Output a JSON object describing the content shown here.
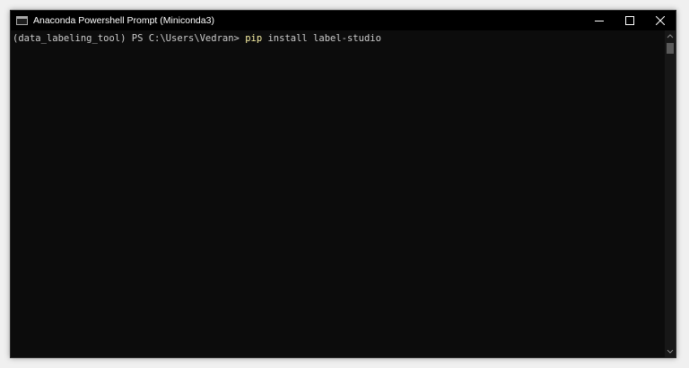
{
  "window": {
    "title": "Anaconda Powershell Prompt (Miniconda3)",
    "icon": "terminal-icon"
  },
  "controls": {
    "minimize": "minimize-icon",
    "maximize": "maximize-icon",
    "close": "close-icon"
  },
  "terminal": {
    "prompt": "(data_labeling_tool) PS C:\\Users\\Vedran> ",
    "command": "pip",
    "arguments": " install label-studio"
  },
  "colors": {
    "background": "#0c0c0c",
    "text": "#cccccc",
    "command": "#f9f1a5",
    "titlebar": "#000000"
  }
}
